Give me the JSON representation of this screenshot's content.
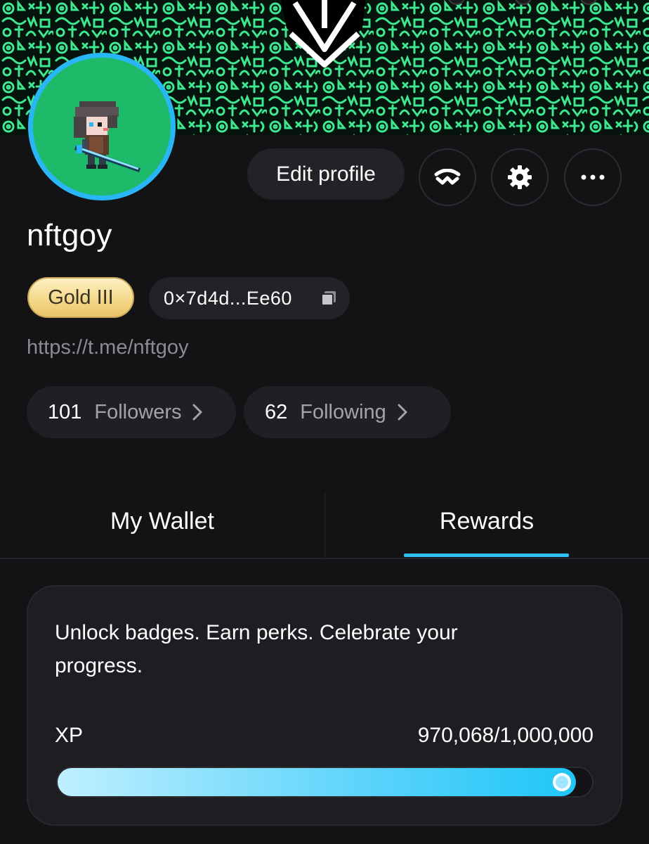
{
  "profile": {
    "username": "nftgoy",
    "rank_badge": "Gold III",
    "wallet_address": "0×7d4d...Ee60",
    "link": "https://t.me/nftgoy",
    "followers_count": "101",
    "followers_label": "Followers",
    "following_count": "62",
    "following_label": "Following"
  },
  "actions": {
    "edit_profile_label": "Edit profile",
    "walletconnect_icon": "walletconnect-icon",
    "settings_icon": "gear-icon",
    "more_icon": "more-dots-icon"
  },
  "tabs": [
    {
      "label": "My Wallet",
      "active": false
    },
    {
      "label": "Rewards",
      "active": true
    }
  ],
  "rewards": {
    "description": "Unlock badges. Earn perks. Celebrate your progress.",
    "xp_label": "XP",
    "xp_text": "970,068/1,000,000",
    "xp_current": 970068,
    "xp_max": 1000000
  },
  "colors": {
    "accent": "#2fbff0",
    "banner_pattern": "#3ee890",
    "avatar_bg": "#1dba6a",
    "avatar_ring": "#29b6f6",
    "gold_badge": "#f4d98a"
  }
}
